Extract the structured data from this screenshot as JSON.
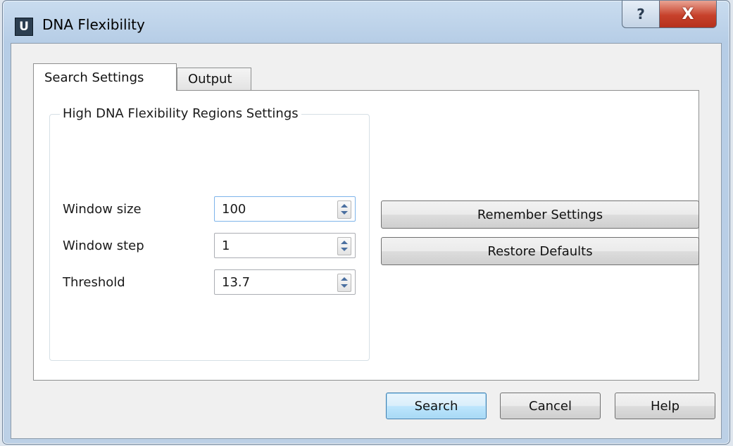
{
  "window": {
    "title": "DNA Flexibility",
    "app_icon_letter": "U",
    "help_glyph": "?",
    "close_glyph": "X"
  },
  "tabs": [
    {
      "label": "Search Settings",
      "active": true
    },
    {
      "label": "Output",
      "active": false
    }
  ],
  "group": {
    "title": "High DNA Flexibility Regions Settings",
    "fields": [
      {
        "label": "Window size",
        "value": "100"
      },
      {
        "label": "Window step",
        "value": "1"
      },
      {
        "label": "Threshold",
        "value": "13.7"
      }
    ]
  },
  "side_buttons": {
    "remember": "Remember Settings",
    "restore": "Restore Defaults"
  },
  "footer": {
    "search": "Search",
    "cancel": "Cancel",
    "help": "Help"
  },
  "icons": {
    "app": "app-logo-icon",
    "help": "question-icon",
    "close": "close-icon",
    "spin_up": "arrow-up-icon",
    "spin_down": "arrow-down-icon"
  },
  "colors": {
    "close_button": "#c7412b",
    "default_button_border": "#3c7fb1",
    "focus_border": "#7eb4ea"
  }
}
